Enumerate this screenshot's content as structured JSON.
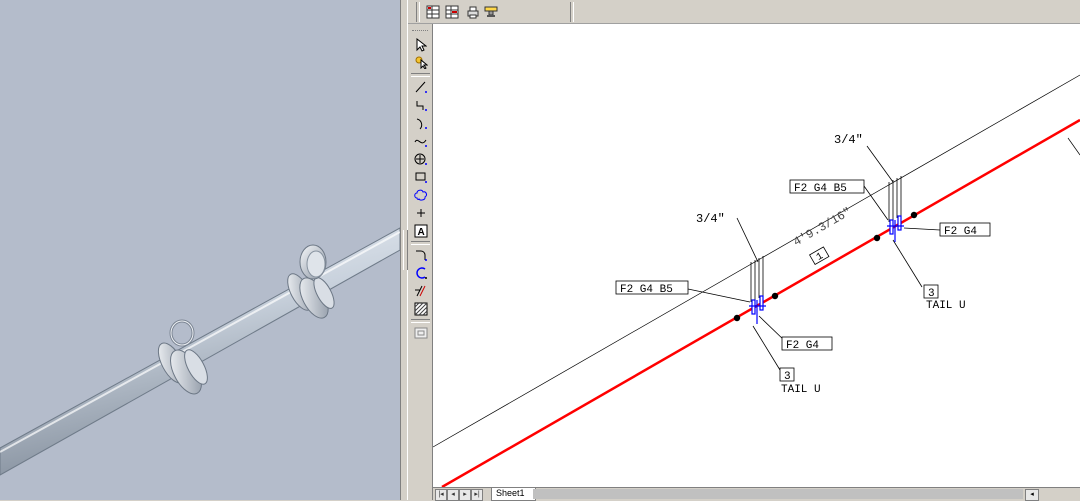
{
  "viewport3d": {
    "background": "#b4bccb"
  },
  "toolbar_top": {
    "buttons": [
      {
        "icon": "table-grid-icon"
      },
      {
        "icon": "table-grid-red-icon"
      },
      {
        "icon": "printer-icon"
      },
      {
        "icon": "stamp-icon"
      }
    ]
  },
  "toolbar_left": {
    "tools": [
      {
        "icon": "select-arrow-icon",
        "glyph": "⇱"
      },
      {
        "icon": "smart-select-icon",
        "glyph": "✶"
      },
      {
        "icon": "line-icon",
        "glyph": "╱"
      },
      {
        "icon": "polyline-icon",
        "glyph": "⌐"
      },
      {
        "icon": "arc-icon",
        "glyph": "⌒"
      },
      {
        "icon": "spline-icon",
        "glyph": "∿"
      },
      {
        "icon": "circle-icon",
        "glyph": "⊕"
      },
      {
        "icon": "rectangle-icon",
        "glyph": "□"
      },
      {
        "icon": "cloud-icon",
        "glyph": "☁"
      },
      {
        "icon": "point-icon",
        "glyph": "+"
      },
      {
        "icon": "text-icon",
        "glyph": "A"
      },
      {
        "icon": "fillet-icon",
        "glyph": "↰"
      },
      {
        "icon": "trim-icon",
        "glyph": "ℂ"
      },
      {
        "icon": "hatch-line-icon",
        "glyph": "⁄⁄"
      },
      {
        "icon": "hatch-pattern-icon",
        "glyph": "▩"
      },
      {
        "icon": "view-icon",
        "glyph": "▣"
      }
    ]
  },
  "drawing": {
    "pipe_color": "#ff0000",
    "weld_color": "#0000ff",
    "dimension_text": "4'9.3/16\"",
    "dimension_tag": "1",
    "weld_upper": {
      "size_label": "3/4\"",
      "fitting_label": "F2 G4 B5",
      "side_label": "F2 G4",
      "count_label": "3",
      "type_label": "TAIL U"
    },
    "weld_lower": {
      "size_label": "3/4\"",
      "fitting_label": "F2 G4 B5",
      "side_label": "F2 G4",
      "count_label": "3",
      "type_label": "TAIL U"
    }
  },
  "sheet_tabs": {
    "active": "Sheet1"
  }
}
